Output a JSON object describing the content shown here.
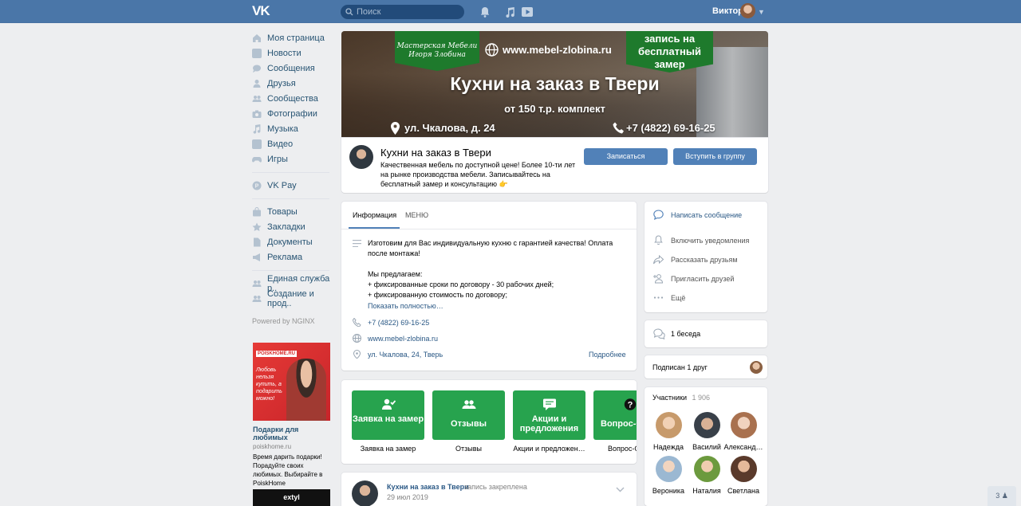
{
  "header": {
    "logo": "VK",
    "search_placeholder": "Поиск",
    "user_name": "Виктор"
  },
  "left_menu": {
    "items": [
      {
        "label": "Моя страница",
        "icon": "home-icon"
      },
      {
        "label": "Новости",
        "icon": "news-icon"
      },
      {
        "label": "Сообщения",
        "icon": "message-icon"
      },
      {
        "label": "Друзья",
        "icon": "user-icon"
      },
      {
        "label": "Сообщества",
        "icon": "users-icon"
      },
      {
        "label": "Фотографии",
        "icon": "camera-icon"
      },
      {
        "label": "Музыка",
        "icon": "music-icon"
      },
      {
        "label": "Видео",
        "icon": "video-icon"
      },
      {
        "label": "Игры",
        "icon": "gamepad-icon"
      }
    ],
    "pay": {
      "label": "VK Pay",
      "icon": "vkpay-icon"
    },
    "items2": [
      {
        "label": "Товары",
        "icon": "bag-icon"
      },
      {
        "label": "Закладки",
        "icon": "star-icon"
      },
      {
        "label": "Документы",
        "icon": "document-icon"
      },
      {
        "label": "Реклама",
        "icon": "megaphone-icon"
      }
    ],
    "items3": [
      {
        "label": "Единая служба р..",
        "icon": "users-icon"
      },
      {
        "label": "Создание и прод..",
        "icon": "users-icon"
      }
    ],
    "powered": "Powered by NGINX"
  },
  "ad": {
    "brand": "POISKHOME.RU",
    "slogan": "Любовь нельзя купить, а подарить можно!",
    "title": "Подарки для любимых",
    "domain": "poiskhome.ru",
    "text": "Время дарить подарки! Порадуйте своих любимых. Выбирайте в PoiskHome",
    "ad2_brand": "extyl"
  },
  "cover": {
    "logo_text": "Мастерская Мебели Игоря Злобина",
    "site": "www.mebel-zlobina.ru",
    "badge": "запись на бесплатный замер",
    "title": "Кухни на заказ в Твери",
    "price": "от 150 т.р. комплект",
    "address": "ул. Чкалова, д. 24",
    "phone": "+7 (4822) 69-16-25"
  },
  "group": {
    "name": "Кухни на заказ в Твери",
    "description": "Качественная мебель по доступной цене! Более 10-ти лет на рынке производства мебели. Записывайтесь на бесплатный замер и консультацию 👉",
    "btn_subscribe": "Записаться",
    "btn_join": "Вступить в группу"
  },
  "info": {
    "tab_info": "Информация",
    "tab_menu": "МЕНЮ",
    "text_line1": "Изготовим для Вас индивидуальную кухню с гарантией качества! Оплата после монтажа!",
    "text_line2": "Мы предлагаем:",
    "text_line3": "+ фиксированные сроки по договору - 30 рабочих дней;",
    "text_line4": "+ фиксированную стоимость по договору;",
    "show_more": "Показать полностью…",
    "phone": "+7 (4822) 69-16-25",
    "site": "www.mebel-zlobina.ru",
    "address": "ул. Чкалова, 24, Тверь",
    "more": "Подробнее"
  },
  "tiles": [
    {
      "label": "Заявка на замер",
      "caption": "Заявка на замер",
      "icon": "user-check-icon"
    },
    {
      "label": "Отзывы",
      "caption": "Отзывы",
      "icon": "users-icon"
    },
    {
      "label": "Акции и предложения",
      "caption": "Акции и предложен…",
      "icon": "chat-icon"
    },
    {
      "label": "Вопрос-О",
      "caption": "Вопрос-О",
      "icon": "question-icon"
    }
  ],
  "post": {
    "author": "Кухни на заказ в Твери",
    "action": "запись закреплена",
    "date": "29 июл 2019"
  },
  "actions": {
    "write": "Написать сообщение",
    "notify": "Включить уведомления",
    "share": "Рассказать друзьям",
    "invite": "Пригласить друзей",
    "more": "Ещё"
  },
  "chat": {
    "label": "1 беседа"
  },
  "friends_sub": {
    "label": "Подписан 1 друг"
  },
  "members": {
    "title": "Участники",
    "count": "1 906",
    "list": [
      "Надежда",
      "Василий",
      "Александ…",
      "Вероника",
      "Наталия",
      "Светлана"
    ]
  },
  "corner": {
    "count": "3"
  }
}
